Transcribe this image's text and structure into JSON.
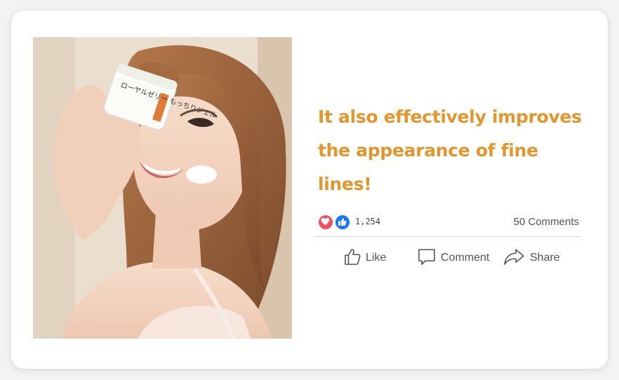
{
  "post": {
    "headline_line1": "It also effectively improves",
    "headline_line2": "the appearance of fine lines!",
    "image_alt": "Woman holding a jar of face cream",
    "product_label": "ローヤルゼリー もっちりジェル"
  },
  "stats": {
    "reaction_count": "1,254",
    "comments": "50 Comments",
    "reaction_icons": [
      "heart-icon",
      "thumbs-up-icon"
    ]
  },
  "actions": {
    "like": "Like",
    "comment": "Comment",
    "share": "Share"
  },
  "colors": {
    "headline": "#e3962b",
    "love": "#f0505f",
    "like": "#1877f2"
  }
}
